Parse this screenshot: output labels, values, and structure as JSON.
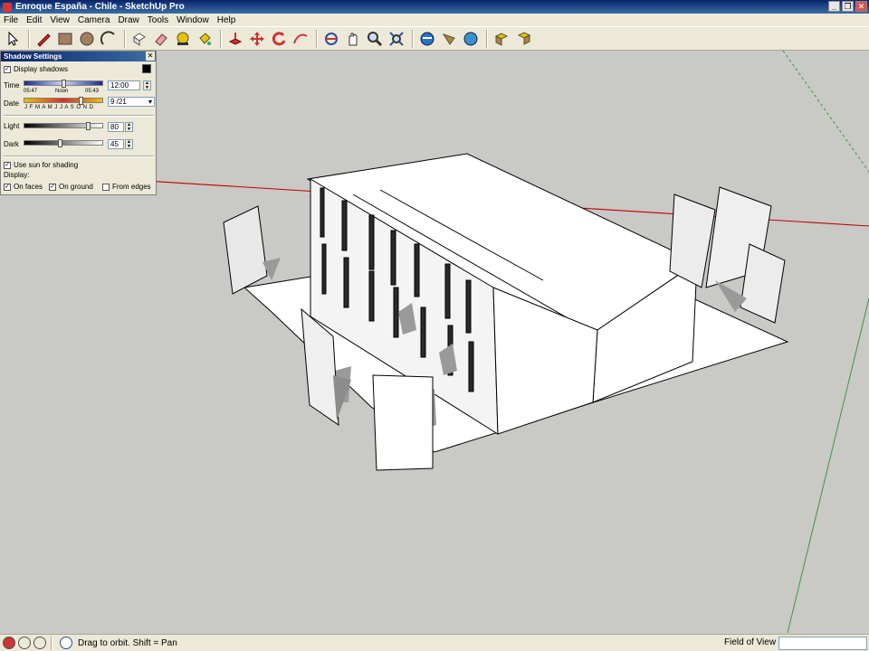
{
  "window": {
    "title": "Enroque España - Chile - SketchUp Pro"
  },
  "menu": [
    "File",
    "Edit",
    "View",
    "Camera",
    "Draw",
    "Tools",
    "Window",
    "Help"
  ],
  "toolbar": {
    "tools": [
      "select-icon",
      "pencil-icon",
      "rectangle-icon",
      "circle-icon",
      "arc-icon",
      "make-component-icon",
      "eraser-icon",
      "tape-measure-icon",
      "paint-bucket-icon",
      "push-pull-icon",
      "move-icon",
      "rotate-icon",
      "follow-me-icon",
      "orbit-icon",
      "pan-icon",
      "zoom-icon",
      "zoom-extents-icon",
      "get-models-icon",
      "share-model-icon",
      "earth-icon",
      "component-a-icon",
      "component-b-icon"
    ]
  },
  "shadow_settings": {
    "title": "Shadow Settings",
    "display_shadows": "Display shadows",
    "time_label": "Time",
    "time_start": "05:47",
    "time_noon": "Noon",
    "time_end": "05:43",
    "time_value": "12:00",
    "date_label": "Date",
    "months": "J F M A M J J A S O N D",
    "date_value": "9 /21",
    "light_label": "Light",
    "light_value": "80",
    "dark_label": "Dark",
    "dark_value": "45",
    "use_sun": "Use sun for shading",
    "display_label": "Display:",
    "on_faces": "On faces",
    "on_ground": "On ground",
    "from_edges": "From edges"
  },
  "status": {
    "hint": "Drag to orbit.  Shift = Pan",
    "vcb_label": "Field of View",
    "vcb_value": ""
  },
  "colors": {
    "title_bar": "#0a246a",
    "viewport_bg": "#c9c9c6",
    "axis_red": "#c00000",
    "axis_green": "#3a9a3a"
  }
}
